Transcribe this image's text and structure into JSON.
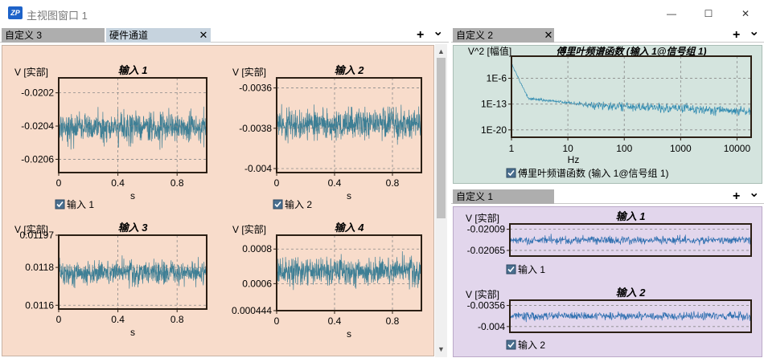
{
  "window": {
    "app_icon_text": "ZP",
    "title": "主视图窗口 1",
    "minimize_glyph": "—",
    "maximize_glyph": "☐",
    "close_glyph": "✕"
  },
  "left_pane": {
    "tabs": [
      {
        "label": "自定义 3",
        "active": true
      },
      {
        "label": "硬件通道",
        "active": false
      }
    ],
    "close_glyph": "✕",
    "add_glyph": "+",
    "menu_glyph": "⌄",
    "background": "#f8dccb",
    "charts": [
      {
        "title": "输入 1",
        "ylabel": "V [实部]",
        "xlabel": "s",
        "yticks": [
          "-0.0202",
          "-0.0204",
          "-0.0206"
        ],
        "ytick_values": [
          -0.0202,
          -0.0204,
          -0.0206
        ],
        "ylim": [
          -0.02068,
          -0.02011
        ],
        "xticks": [
          "0",
          "0.4",
          "0.8"
        ],
        "xtick_values": [
          0,
          0.4,
          0.8
        ],
        "xlim": [
          0,
          1
        ],
        "center": -0.02041,
        "amp": 0.00012,
        "legend": "输入 1",
        "seed": 11
      },
      {
        "title": "输入 2",
        "ylabel": "V [实部]",
        "xlabel": "s",
        "yticks": [
          "-0.0036",
          "-0.0038",
          "-0.004"
        ],
        "ytick_values": [
          -0.0036,
          -0.0038,
          -0.004
        ],
        "ylim": [
          -0.00402,
          -0.00355
        ],
        "xticks": [
          "0",
          "0.4",
          "0.8"
        ],
        "xtick_values": [
          0,
          0.4,
          0.8
        ],
        "xlim": [
          0,
          1
        ],
        "center": -0.00378,
        "amp": 0.0001,
        "legend": "输入 2",
        "seed": 23
      },
      {
        "title": "输入 3",
        "ylabel": "V [实部]",
        "xlabel": "s",
        "yticks": [
          "0.01197",
          "0.0118",
          "0.0116"
        ],
        "ytick_values": [
          0.01197,
          0.0118,
          0.0116
        ],
        "ylim": [
          0.01158,
          0.01197
        ],
        "xticks": [
          "0",
          "0.4",
          "0.8"
        ],
        "xtick_values": [
          0,
          0.4,
          0.8
        ],
        "xlim": [
          0,
          1
        ],
        "center": 0.01177,
        "amp": 8e-05,
        "legend": "输入 3",
        "seed": 37
      },
      {
        "title": "输入 4",
        "ylabel": "V [实部]",
        "xlabel": "s",
        "yticks": [
          "0.0008",
          "0.0006",
          "0.000444"
        ],
        "ytick_values": [
          0.0008,
          0.0006,
          0.000444
        ],
        "ylim": [
          0.000444,
          0.00088
        ],
        "xticks": [
          "0",
          "0.4",
          "0.8"
        ],
        "xtick_values": [
          0,
          0.4,
          0.8
        ],
        "xlim": [
          0,
          1
        ],
        "center": 0.00067,
        "amp": 0.0001,
        "legend": "输入 4",
        "seed": 53
      }
    ]
  },
  "right_top_pane": {
    "tabs": [
      {
        "label": "自定义 2",
        "active": true
      }
    ],
    "close_glyph": "✕",
    "add_glyph": "+",
    "menu_glyph": "⌄",
    "background": "#d4e4de",
    "chart": {
      "type": "line",
      "scale": "log-log",
      "title": "傅里叶频谱函数 (输入 1@信号组 1)",
      "ylabel": "V^2 [幅值]",
      "xlabel": "Hz",
      "yticks": [
        "1E-6",
        "1E-13",
        "1E-20"
      ],
      "ytick_exponents": [
        -6,
        -13,
        -20
      ],
      "ylim_exponents": [
        -22,
        0
      ],
      "xticks": [
        "1",
        "10",
        "100",
        "1000",
        "10000"
      ],
      "xtick_exponents": [
        0,
        1,
        2,
        3,
        4
      ],
      "xlim_exponents": [
        0,
        4.25
      ],
      "legend": "傅里叶频谱函数 (输入 1@信号组 1)"
    }
  },
  "right_bottom_pane": {
    "tabs": [
      {
        "label": "自定义 1",
        "active": true
      }
    ],
    "add_glyph": "+",
    "menu_glyph": "⌄",
    "background": "#e2d6ec",
    "charts": [
      {
        "title": "输入 1",
        "ylabel": "V [实部]",
        "yticks": [
          "-0.02009",
          "-0.02065"
        ],
        "ytick_values": [
          -0.02009,
          -0.02065
        ],
        "ylim": [
          -0.0208,
          -0.01995
        ],
        "center": -0.02038,
        "amp": 0.00014,
        "legend": "输入 1",
        "seed": 71
      },
      {
        "title": "输入 2",
        "ylabel": "V [实部]",
        "yticks": [
          "-0.00356",
          "-0.004"
        ],
        "ytick_values": [
          -0.00356,
          -0.004
        ],
        "ylim": [
          -0.00412,
          -0.00345
        ],
        "center": -0.00378,
        "amp": 0.00011,
        "legend": "输入 2",
        "seed": 89
      }
    ]
  },
  "colors": {
    "signal": "#3e7f95",
    "signal_blue": "#2e6fb0",
    "grid": "#8a8a8a",
    "frame": "#2b1f14",
    "checkbox": "#4a6f8f"
  }
}
